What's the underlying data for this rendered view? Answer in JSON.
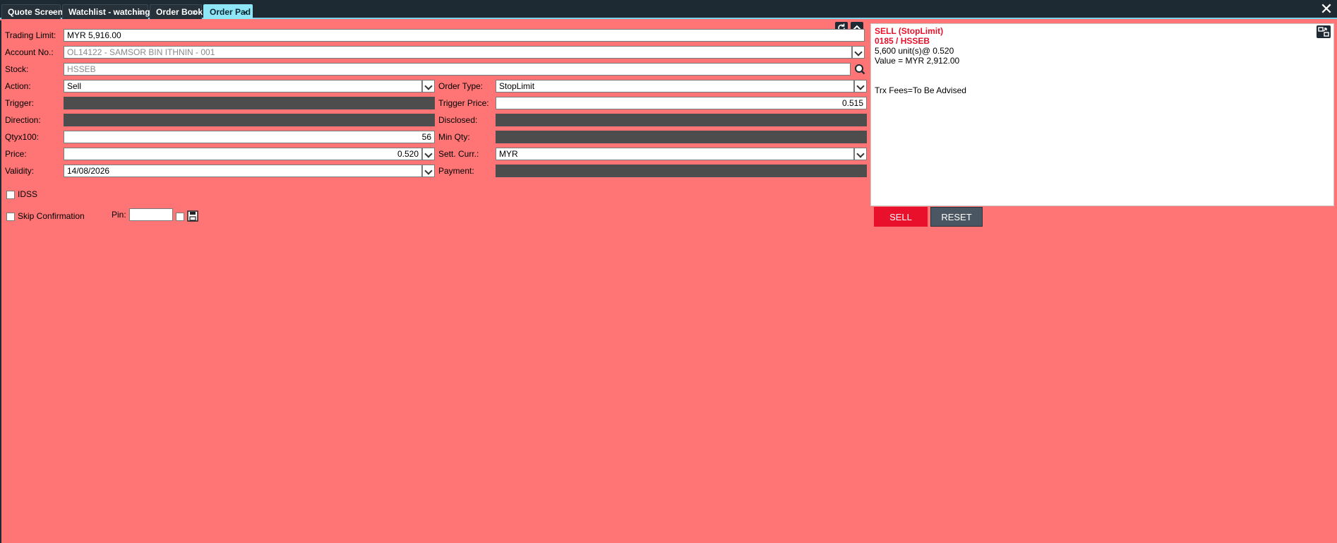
{
  "tabs": [
    {
      "label": "Quote Screen",
      "active": false
    },
    {
      "label": "Watchlist - watching",
      "active": false
    },
    {
      "label": "Order Book",
      "active": false
    },
    {
      "label": "Order Pad",
      "active": true
    }
  ],
  "tab_close_glyph": "×",
  "window_close_glyph": "✕",
  "form": {
    "trading_limit": {
      "label": "Trading Limit:",
      "value": "MYR 5,916.00"
    },
    "account": {
      "label": "Account No.:",
      "value": "OL14122 - SAMSOR BIN ITHNIN - 001"
    },
    "stock": {
      "label": "Stock:",
      "value": "HSSEB"
    },
    "action": {
      "label": "Action:",
      "value": "Sell"
    },
    "trigger": {
      "label": "Trigger:",
      "value": ""
    },
    "direction": {
      "label": "Direction:",
      "value": ""
    },
    "qty": {
      "label": "Qtyx100:",
      "value": "56"
    },
    "price": {
      "label": "Price:",
      "value": "0.520"
    },
    "validity": {
      "label": "Validity:",
      "value": "14/08/2026"
    },
    "order_type": {
      "label": "Order Type:",
      "value": "StopLimit"
    },
    "trigger_price": {
      "label": "Trigger Price:",
      "value": "0.515"
    },
    "disclosed": {
      "label": "Disclosed:",
      "value": ""
    },
    "min_qty": {
      "label": "Min Qty:",
      "value": ""
    },
    "sett_curr": {
      "label": "Sett. Curr.:",
      "value": "MYR"
    },
    "payment": {
      "label": "Payment:",
      "value": ""
    },
    "idss": {
      "label": "IDSS",
      "checked": false
    },
    "skip_confirmation": {
      "label": "Skip Confirmation",
      "checked": false
    },
    "pin": {
      "label": "Pin:",
      "value": ""
    }
  },
  "summary": {
    "line1": "SELL (StopLimit)",
    "line2": "0185 / HSSEB",
    "line3": "5,600 unit(s)@ 0.520",
    "line4": "Value = MYR 2,912.00",
    "line5": "Trx Fees=To Be Advised"
  },
  "buttons": {
    "sell": "SELL",
    "reset": "RESET"
  },
  "colors": {
    "panel_bg": "#ff7575",
    "sell": "#e8102a",
    "tab_active": "#8ee6f7",
    "tabbar": "#1e2a33"
  },
  "icons": [
    "refresh-icon",
    "collapse-icon",
    "search-icon",
    "save-icon",
    "expand-icon",
    "close-icon",
    "chevron-down-icon"
  ]
}
